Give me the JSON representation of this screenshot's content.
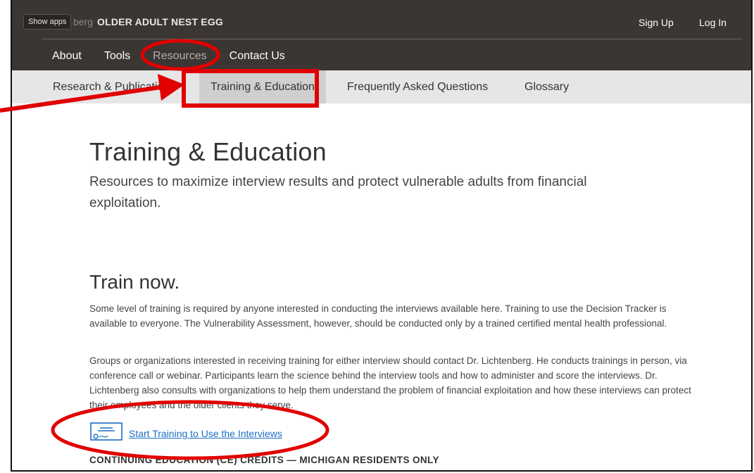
{
  "header": {
    "show_apps": "Show apps",
    "logo_prefix": "berg",
    "logo_main": "OLDER ADULT NEST EGG",
    "signup": "Sign Up",
    "login": "Log In"
  },
  "nav": {
    "items": [
      {
        "label": "About"
      },
      {
        "label": "Tools"
      },
      {
        "label": "Resources"
      },
      {
        "label": "Contact Us"
      }
    ]
  },
  "subnav": {
    "items": [
      {
        "label": "Research & Publications"
      },
      {
        "label": "Training & Education"
      },
      {
        "label": "Frequently Asked Questions"
      },
      {
        "label": "Glossary"
      }
    ]
  },
  "page": {
    "title": "Training & Education",
    "lede": "Resources to maximize interview results and protect vulnerable adults from financial exploitation.",
    "section_title": "Train now.",
    "p1": "Some level of training is required by anyone interested in conducting the interviews available here. Training to use the Decision Tracker is available to everyone. The Vulnerability Assessment, however, should be conducted only by a trained certified mental health professional.",
    "p2": "Groups or organizations interested in receiving training for either interview should contact Dr. Lichtenberg. He conducts trainings in person, via conference call or webinar. Participants learn the science behind the interview tools and how to administer and score the interviews. Dr. Lichtenberg also consults with organizations to help them understand the problem of financial exploitation and how these interviews can protect their employees and the older clients they serve.",
    "cta_label": "Start Training to Use the Interviews",
    "ce_heading": "CONTINUING EDUCATION (CE) CREDITS — MICHIGAN RESIDENTS ONLY"
  },
  "icons": {
    "cta_icon": "certificate-icon"
  },
  "colors": {
    "header_bg": "#3b3634",
    "subnav_bg": "#e6e6e6",
    "annotation_red": "#e10000",
    "link": "#1b6ec2"
  }
}
